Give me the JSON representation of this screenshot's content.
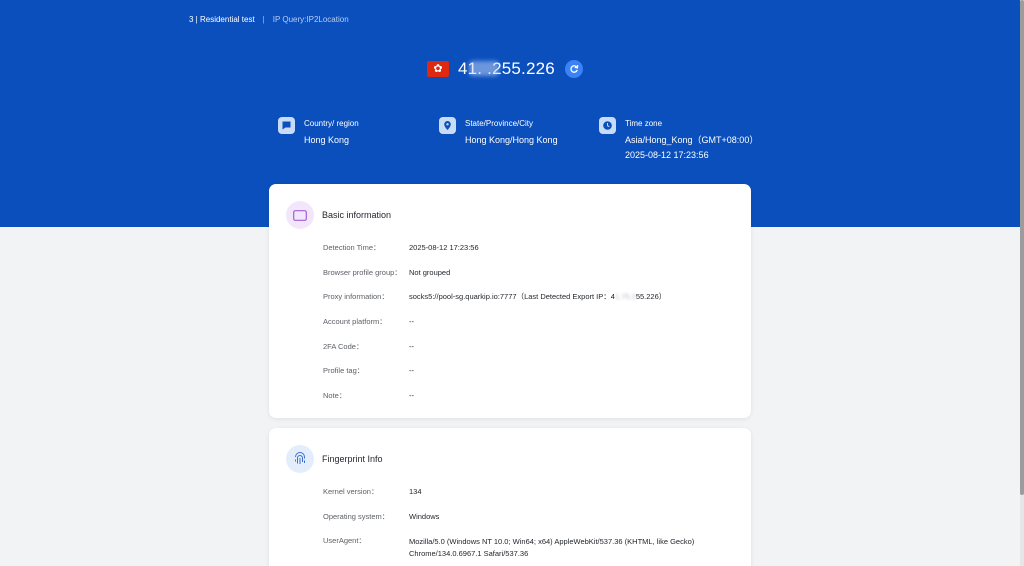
{
  "breadcrumb": {
    "current": "3 | Residential test",
    "separator": "|",
    "sub": "IP Query:IP2Location"
  },
  "ip": {
    "flag_icon": "hong-kong-flag-icon",
    "value": "41.  .255.226"
  },
  "geo": [
    {
      "icon": "chat-flag-icon",
      "label": "Country/ region",
      "value": "Hong Kong"
    },
    {
      "icon": "location-pin-icon",
      "label": "State/Province/City",
      "value": "Hong Kong/Hong Kong"
    },
    {
      "icon": "clock-icon",
      "label": "Time zone",
      "value": "Asia/Hong_Kong（GMT+08:00）",
      "value2": "2025-08-12 17:23:56"
    }
  ],
  "basic": {
    "title": "Basic information",
    "rows": [
      {
        "key": "Detection Time：",
        "value": "2025-08-12 17:23:56"
      },
      {
        "key": "Browser profile group：",
        "value": "Not grouped"
      },
      {
        "key": "Proxy information：",
        "value": "socks5://pool-sg.quarkip.io:7777（Last Detected Export IP：4",
        "value_blur": "1.75.2",
        "value_tail": "55.226）"
      },
      {
        "key": "Account platform：",
        "value": "--"
      },
      {
        "key": "2FA Code：",
        "value": "--"
      },
      {
        "key": "Profile tag：",
        "value": "--"
      },
      {
        "key": "Note：",
        "value": "--"
      }
    ]
  },
  "fingerprint": {
    "title": "Fingerprint Info",
    "rows": [
      {
        "key": "Kernel version：",
        "value": "134"
      },
      {
        "key": "Operating system：",
        "value": "Windows"
      },
      {
        "key": "UserAgent：",
        "value": "Mozilla/5.0 (Windows NT 10.0; Win64; x64) AppleWebKit/537.36 (KHTML, like Gecko)",
        "value2": "Chrome/134.0.6967.1 Safari/537.36"
      }
    ]
  },
  "colors": {
    "hero": "#0b4fbd",
    "accent": "#3b82f6",
    "flag": "#de2910"
  }
}
